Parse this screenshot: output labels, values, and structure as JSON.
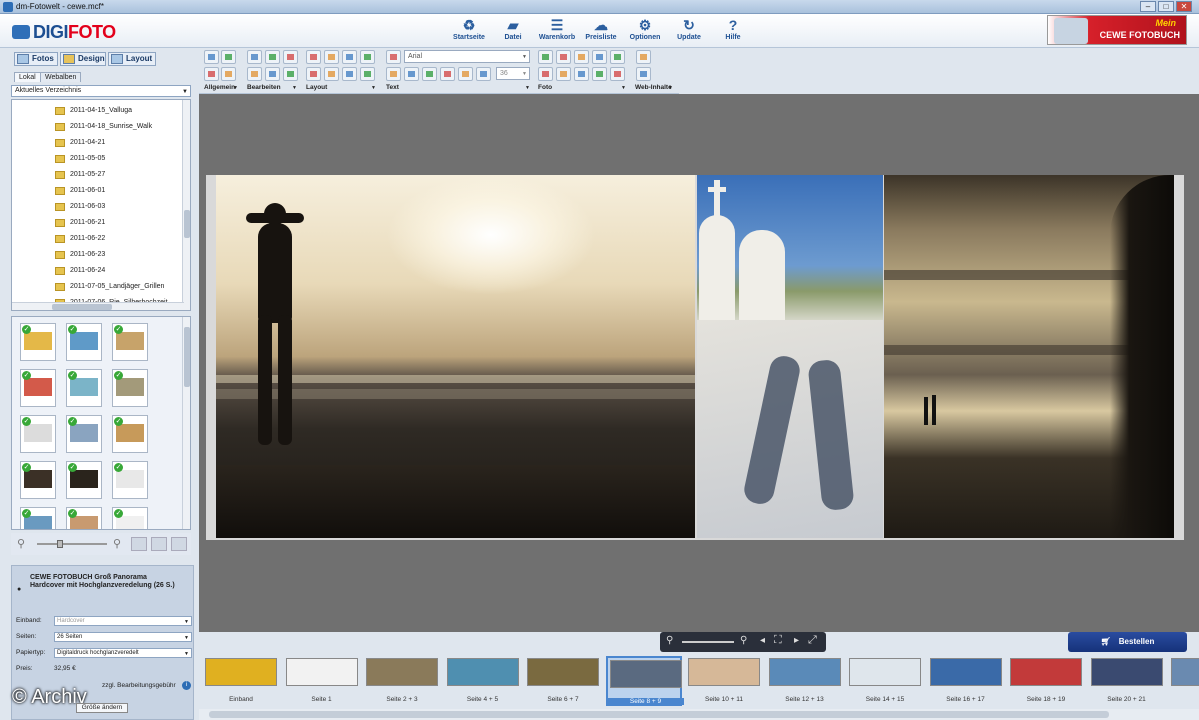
{
  "window": {
    "title": "dm-Fotowelt - cewe.mcf*",
    "minimize": "–",
    "maximize": "□",
    "close": "✕"
  },
  "header": {
    "logo_prefix": "DIGI",
    "logo_suffix": "FOTO",
    "nav": [
      {
        "label": "Startseite",
        "icon": "gear-steps-icon",
        "glyph": "♻"
      },
      {
        "label": "Datei",
        "icon": "folder-icon",
        "glyph": "▰"
      },
      {
        "label": "Warenkorb",
        "icon": "cart-icon",
        "glyph": "☰"
      },
      {
        "label": "Preisliste",
        "icon": "cloud-icon",
        "glyph": "☁"
      },
      {
        "label": "Optionen",
        "icon": "settings-icon",
        "glyph": "⚙"
      },
      {
        "label": "Update",
        "icon": "refresh-icon",
        "glyph": "↻"
      },
      {
        "label": "Hilfe",
        "icon": "help-icon",
        "glyph": "?"
      }
    ],
    "banner": {
      "line1": "Mein",
      "line2": "CEWE FOTOBUCH"
    }
  },
  "left_panel": {
    "tabs": [
      "Fotos",
      "Design",
      "Layout"
    ],
    "subtabs": [
      "Lokal",
      "Webalben"
    ],
    "directory": "Aktuelles Verzeichnis",
    "folders": [
      "2011-04-15_Valluga",
      "2011-04-18_Sunrise_Walk",
      "2011-04-21",
      "2011-05-05",
      "2011-05-27",
      "2011-06-01",
      "2011-06-03",
      "2011-06-21",
      "2011-06-22",
      "2011-06-23",
      "2011-06-24",
      "2011-07-05_Landjäger_Grillen",
      "2011-07-06_Rie_Silberhochzeit"
    ],
    "product": {
      "title": "CEWE FOTOBUCH Groß Panorama Hardcover mit Hochglanzveredelung (26 S.)",
      "rows": [
        {
          "label": "Einband:",
          "value": "Hardcover"
        },
        {
          "label": "Seiten:",
          "value": "26 Seiten"
        },
        {
          "label": "Papiertyp:",
          "value": "Digitaldruck hochglanzveredelt"
        }
      ],
      "price_label": "Preis:",
      "price": "32,95 €",
      "fee": "zzgl. Bearbeitungsgebühr",
      "resize_btn": "Größe ändern"
    }
  },
  "toolbar": {
    "groups": [
      "Allgemein",
      "Bearbeiten",
      "Layout",
      "Text",
      "Foto",
      "Web-Inhalte"
    ],
    "font": "Arial",
    "size": "36"
  },
  "bottom": {
    "order_button": "Bestellen",
    "watermark": "© Archiv"
  },
  "pages": [
    {
      "label": "Einband",
      "color": "#e0b020"
    },
    {
      "label": "Seite 1",
      "color": "#f2f2f2"
    },
    {
      "label": "Seite 2 + 3",
      "color": "#8a7a5a"
    },
    {
      "label": "Seite 4 + 5",
      "color": "#4f8fb0"
    },
    {
      "label": "Seite 6 + 7",
      "color": "#7a6a40"
    },
    {
      "label": "Seite 8 + 9",
      "color": "#5a6a80",
      "selected": true
    },
    {
      "label": "Seite 10 + 11",
      "color": "#d6b898"
    },
    {
      "label": "Seite 12 + 13",
      "color": "#5a8ab8"
    },
    {
      "label": "Seite 14 + 15",
      "color": "#dfe6ec"
    },
    {
      "label": "Seite 16 + 17",
      "color": "#3a6aa8"
    },
    {
      "label": "Seite 18 + 19",
      "color": "#c23a3a"
    },
    {
      "label": "Seite 20 + 21",
      "color": "#3a4a70"
    },
    {
      "label": "",
      "color": "#6a8ab0"
    }
  ]
}
